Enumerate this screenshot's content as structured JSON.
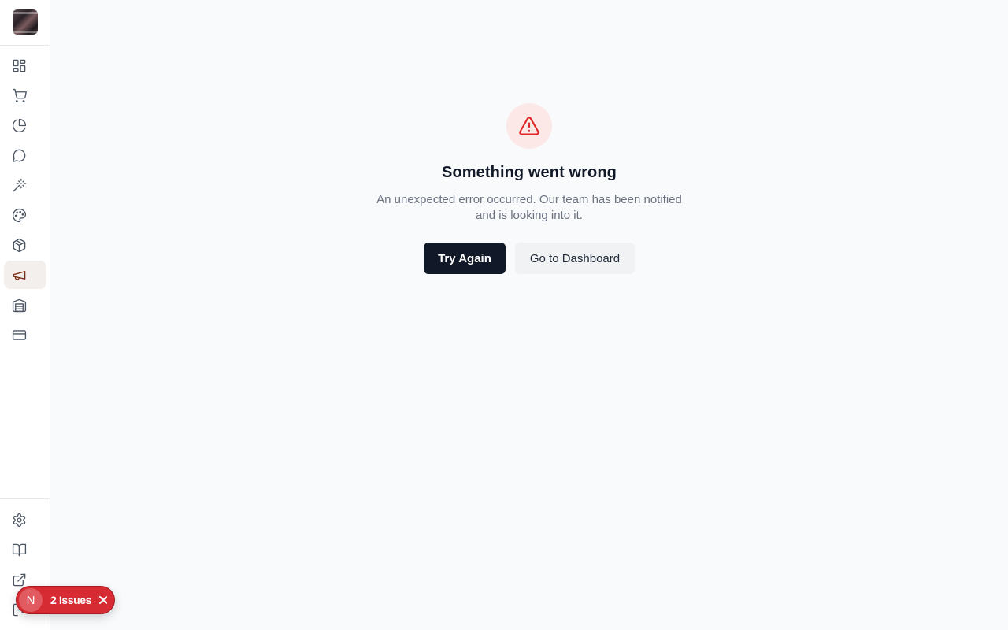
{
  "sidebar": {
    "logo": "store-logo",
    "items": [
      {
        "icon": "dashboard-grid-icon"
      },
      {
        "icon": "shopping-cart-icon"
      },
      {
        "icon": "analytics-pie-icon"
      },
      {
        "icon": "chat-bubble-icon"
      },
      {
        "icon": "magic-wand-icon"
      },
      {
        "icon": "palette-icon"
      },
      {
        "icon": "package-box-icon"
      },
      {
        "icon": "megaphone-icon",
        "active": true
      },
      {
        "icon": "warehouse-icon"
      },
      {
        "icon": "credit-card-icon"
      }
    ],
    "bottom_items": [
      {
        "icon": "settings-gear-icon"
      },
      {
        "icon": "book-open-icon"
      },
      {
        "icon": "external-link-icon"
      },
      {
        "icon": "logout-icon"
      }
    ],
    "active_color": "#7c2d12"
  },
  "error": {
    "icon": "alert-triangle-icon",
    "title": "Something went wrong",
    "message": "An unexpected error occurred. Our team has been notified and is looking into it.",
    "primary_button": "Try Again",
    "secondary_button": "Go to Dashboard",
    "accent_color": "#dc2626"
  },
  "issues_badge": {
    "avatar_letter": "N",
    "label": "2 Issues",
    "color": "#d62b33"
  }
}
